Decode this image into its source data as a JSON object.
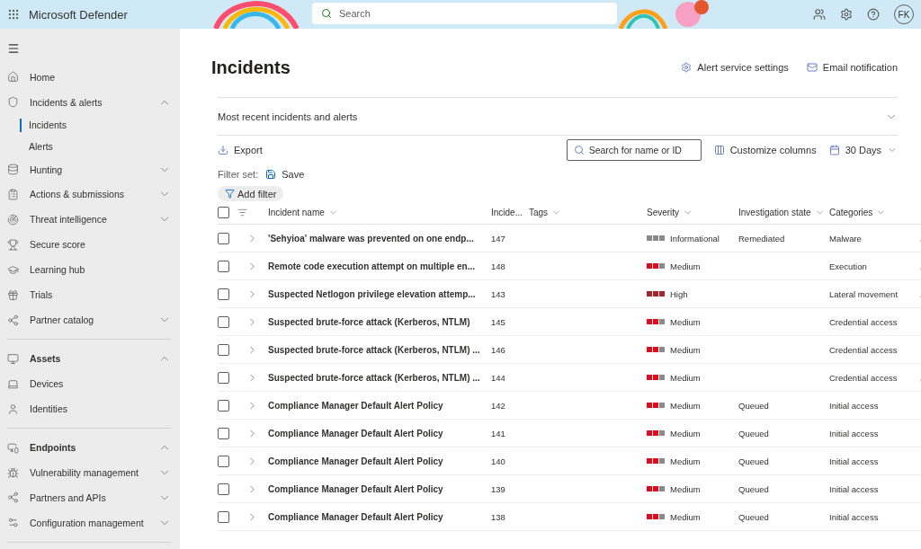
{
  "app": {
    "title": "Microsoft Defender",
    "search_placeholder": "Search",
    "avatar": "FK"
  },
  "sidebar": {
    "items": [
      {
        "kind": "item",
        "label": "Home"
      },
      {
        "kind": "item",
        "label": "Incidents & alerts",
        "expanded": true,
        "children": [
          {
            "label": "Incidents",
            "selected": true
          },
          {
            "label": "Alerts",
            "selected": false
          }
        ]
      },
      {
        "kind": "item",
        "label": "Hunting",
        "expanded": false
      },
      {
        "kind": "item",
        "label": "Actions & submissions",
        "expanded": false
      },
      {
        "kind": "item",
        "label": "Threat intelligence",
        "expanded": false
      },
      {
        "kind": "item",
        "label": "Secure score"
      },
      {
        "kind": "item",
        "label": "Learning hub"
      },
      {
        "kind": "item",
        "label": "Trials"
      },
      {
        "kind": "item",
        "label": "Partner catalog",
        "expanded": false
      },
      {
        "kind": "divider"
      },
      {
        "kind": "section",
        "label": "Assets",
        "expanded": true
      },
      {
        "kind": "item",
        "label": "Devices"
      },
      {
        "kind": "item",
        "label": "Identities"
      },
      {
        "kind": "divider"
      },
      {
        "kind": "section",
        "label": "Endpoints",
        "expanded": true
      },
      {
        "kind": "item",
        "label": "Vulnerability management",
        "expanded": false
      },
      {
        "kind": "item",
        "label": "Partners and APIs",
        "expanded": false
      },
      {
        "kind": "item",
        "label": "Configuration management",
        "expanded": false
      },
      {
        "kind": "divider"
      }
    ]
  },
  "page": {
    "title": "Incidents",
    "actions": [
      {
        "label": "Alert service settings"
      },
      {
        "label": "Email notification"
      }
    ],
    "summary_panel": {
      "label": "Most recent incidents and alerts",
      "expanded": false
    },
    "export": "Export",
    "search_placeholder": "Search for name or ID",
    "customize": "Customize columns",
    "range": "30 Days",
    "filter_set_label": "Filter set:",
    "save": "Save",
    "add_filter": "Add filter"
  },
  "table": {
    "select_all_checked": false,
    "columns": [
      "Incident name",
      "Incide...",
      "Tags",
      "Severity",
      "Investigation state",
      "Categories"
    ],
    "rows": [
      {
        "checked": false,
        "name": "'Sehyioa' malware was prevented on one endp...",
        "id": "147",
        "severity": {
          "kind": "informational",
          "label": "Informational"
        },
        "state": "Remediated",
        "category": "Malware",
        "impacted_user": true
      },
      {
        "checked": false,
        "name": "Remote code execution attempt on multiple en...",
        "id": "148",
        "severity": {
          "kind": "medium",
          "label": "Medium"
        },
        "category": "Execution",
        "impacted_user": true
      },
      {
        "checked": false,
        "name": "Suspected Netlogon privilege elevation attemp...",
        "id": "143",
        "severity": {
          "kind": "high",
          "label": "High"
        },
        "category": "Lateral movement",
        "impacted_user": true
      },
      {
        "checked": false,
        "name": "Suspected brute-force attack (Kerberos, NTLM)",
        "id": "145",
        "severity": {
          "kind": "medium",
          "label": "Medium"
        },
        "category": "Credential access",
        "impacted_user": false
      },
      {
        "checked": false,
        "name": "Suspected brute-force attack (Kerberos, NTLM) ...",
        "id": "146",
        "severity": {
          "kind": "medium",
          "label": "Medium"
        },
        "category": "Credential access",
        "impacted_user": false
      },
      {
        "checked": false,
        "name": "Suspected brute-force attack (Kerberos, NTLM) ...",
        "id": "144",
        "severity": {
          "kind": "medium",
          "label": "Medium"
        },
        "category": "Credential access",
        "impacted_user": true
      },
      {
        "checked": false,
        "name": "Compliance Manager Default Alert Policy",
        "id": "142",
        "severity": {
          "kind": "medium",
          "label": "Medium"
        },
        "state": "Queued",
        "category": "Initial access",
        "impacted_user": false
      },
      {
        "checked": false,
        "name": "Compliance Manager Default Alert Policy",
        "id": "141",
        "severity": {
          "kind": "medium",
          "label": "Medium"
        },
        "state": "Queued",
        "category": "Initial access",
        "impacted_user": false
      },
      {
        "checked": false,
        "name": "Compliance Manager Default Alert Policy",
        "id": "140",
        "severity": {
          "kind": "medium",
          "label": "Medium"
        },
        "state": "Queued",
        "category": "Initial access",
        "impacted_user": false
      },
      {
        "checked": false,
        "name": "Compliance Manager Default Alert Policy",
        "id": "139",
        "severity": {
          "kind": "medium",
          "label": "Medium"
        },
        "state": "Queued",
        "category": "Initial access",
        "impacted_user": false
      },
      {
        "checked": false,
        "name": "Compliance Manager Default Alert Policy",
        "id": "138",
        "severity": {
          "kind": "medium",
          "label": "Medium"
        },
        "state": "Queued",
        "category": "Initial access",
        "impacted_user": false
      }
    ]
  }
}
